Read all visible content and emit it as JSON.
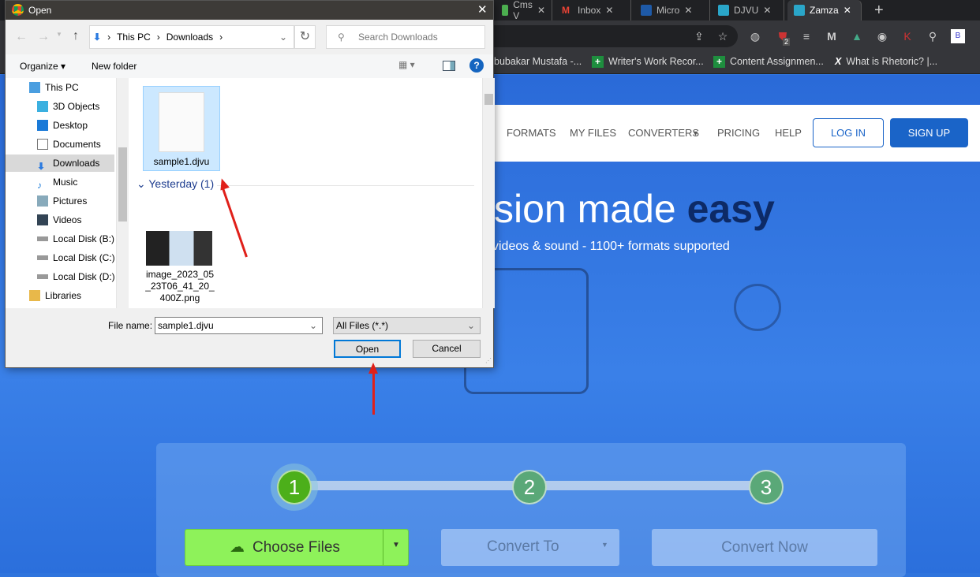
{
  "browser": {
    "tabs": [
      {
        "label": "Cms V",
        "favicon": "#4caf50"
      },
      {
        "label": "Inbox",
        "favicon": "#ea4335"
      },
      {
        "label": "Micro",
        "favicon": "#1e5aa8"
      },
      {
        "label": "DJVU",
        "favicon": "#2aa6c9"
      },
      {
        "label": "Zamza",
        "favicon": "#2aa6c9",
        "active": true
      }
    ],
    "new_tab": "+",
    "extension_badge": "2",
    "bookmarks": [
      {
        "label": "bubakar Mustafa -..."
      },
      {
        "label": "Writer's Work Recor...",
        "icon": "sheets-icon"
      },
      {
        "label": "Content Assignmen...",
        "icon": "sheets-icon"
      },
      {
        "label": "What is Rhetoric? |...",
        "icon": "x-icon"
      }
    ]
  },
  "site": {
    "nav": [
      "FORMATS",
      "MY FILES",
      "CONVERTERS",
      "PRICING",
      "HELP"
    ],
    "login": "LOG IN",
    "signup": "SIGN UP",
    "headline": "sion made ",
    "headline_bold": "easy",
    "subtitle": "videos & sound - 1100+ formats supported",
    "steps": [
      "1",
      "2",
      "3"
    ],
    "choose_files": "Choose Files",
    "convert_to": "Convert To",
    "convert_now": "Convert Now",
    "accent": "#1a64c8",
    "step_active_color": "#4caf1a"
  },
  "dialog": {
    "title": "Open",
    "breadcrumb": [
      "This PC",
      "Downloads"
    ],
    "search_placeholder": "Search Downloads",
    "organize": "Organize",
    "new_folder": "New folder",
    "tree": [
      "This PC",
      "3D Objects",
      "Desktop",
      "Documents",
      "Downloads",
      "Music",
      "Pictures",
      "Videos",
      "Local Disk (B:)",
      "Local Disk (C:)",
      "Local Disk (D:)",
      "Libraries"
    ],
    "selected_tree": "Downloads",
    "group_header": "Yesterday (1)",
    "files": [
      {
        "name": "sample1.djvu",
        "selected": true
      },
      {
        "name": "image_2023_05_23T06_41_20_400Z.png"
      }
    ],
    "file_name_label": "File name:",
    "file_name_value": "sample1.djvu",
    "file_type": "All Files (*.*)",
    "open": "Open",
    "cancel": "Cancel"
  }
}
